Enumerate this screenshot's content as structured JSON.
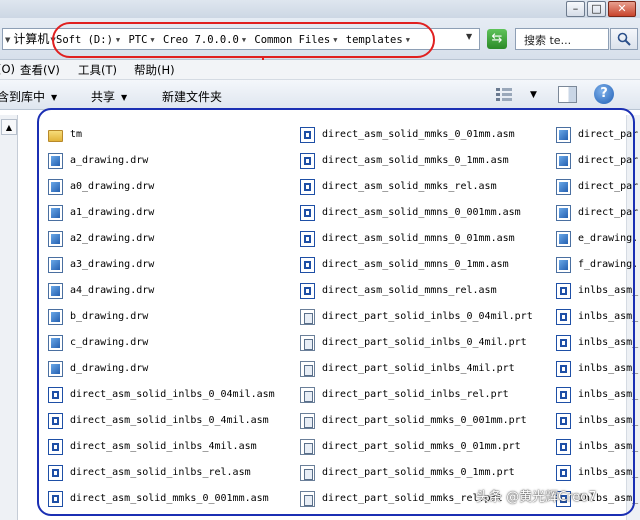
{
  "address": {
    "computer_label": "计算机",
    "breadcrumbs": [
      "Soft (D:)",
      "PTC",
      "Creo 7.0.0.0",
      "Common Files",
      "templates"
    ],
    "search_placeholder": "搜索 te..."
  },
  "menu": [
    {
      "label": "(O)"
    },
    {
      "label": "查看(V)"
    },
    {
      "label": "工具(T)"
    },
    {
      "label": "帮助(H)"
    }
  ],
  "toolbar": {
    "include_in_library": "含到库中",
    "share": "共享",
    "new_folder": "新建文件夹"
  },
  "files": [
    [
      {
        "name": "tm",
        "type": "folder"
      },
      {
        "name": "a_drawing.drw",
        "type": "drw"
      },
      {
        "name": "a0_drawing.drw",
        "type": "drw"
      },
      {
        "name": "a1_drawing.drw",
        "type": "drw"
      },
      {
        "name": "a2_drawing.drw",
        "type": "drw"
      },
      {
        "name": "a3_drawing.drw",
        "type": "drw"
      },
      {
        "name": "a4_drawing.drw",
        "type": "drw"
      },
      {
        "name": "b_drawing.drw",
        "type": "drw"
      },
      {
        "name": "c_drawing.drw",
        "type": "drw"
      },
      {
        "name": "d_drawing.drw",
        "type": "drw"
      },
      {
        "name": "direct_asm_solid_inlbs_0_04mil.asm",
        "type": "asm"
      },
      {
        "name": "direct_asm_solid_inlbs_0_4mil.asm",
        "type": "asm"
      },
      {
        "name": "direct_asm_solid_inlbs_4mil.asm",
        "type": "asm"
      },
      {
        "name": "direct_asm_solid_inlbs_rel.asm",
        "type": "asm"
      },
      {
        "name": "direct_asm_solid_mmks_0_001mm.asm",
        "type": "asm"
      }
    ],
    [
      {
        "name": "direct_asm_solid_mmks_0_01mm.asm",
        "type": "asm"
      },
      {
        "name": "direct_asm_solid_mmks_0_1mm.asm",
        "type": "asm"
      },
      {
        "name": "direct_asm_solid_mmks_rel.asm",
        "type": "asm"
      },
      {
        "name": "direct_asm_solid_mmns_0_001mm.asm",
        "type": "asm"
      },
      {
        "name": "direct_asm_solid_mmns_0_01mm.asm",
        "type": "asm"
      },
      {
        "name": "direct_asm_solid_mmns_0_1mm.asm",
        "type": "asm"
      },
      {
        "name": "direct_asm_solid_mmns_rel.asm",
        "type": "asm"
      },
      {
        "name": "direct_part_solid_inlbs_0_04mil.prt",
        "type": "prt"
      },
      {
        "name": "direct_part_solid_inlbs_0_4mil.prt",
        "type": "prt"
      },
      {
        "name": "direct_part_solid_inlbs_4mil.prt",
        "type": "prt"
      },
      {
        "name": "direct_part_solid_inlbs_rel.prt",
        "type": "prt"
      },
      {
        "name": "direct_part_solid_mmks_0_001mm.prt",
        "type": "prt"
      },
      {
        "name": "direct_part_solid_mmks_0_01mm.prt",
        "type": "prt"
      },
      {
        "name": "direct_part_solid_mmks_0_1mm.prt",
        "type": "prt"
      },
      {
        "name": "direct_part_solid_mmks_rel.prt",
        "type": "prt"
      }
    ],
    [
      {
        "name": "direct_par",
        "type": "drw"
      },
      {
        "name": "direct_par",
        "type": "drw"
      },
      {
        "name": "direct_par",
        "type": "drw"
      },
      {
        "name": "direct_par",
        "type": "drw"
      },
      {
        "name": "e_drawing.",
        "type": "drw"
      },
      {
        "name": "f_drawing.",
        "type": "drw"
      },
      {
        "name": "inlbs_asm_",
        "type": "asm"
      },
      {
        "name": "inlbs_asm_",
        "type": "asm"
      },
      {
        "name": "inlbs_asm_",
        "type": "asm"
      },
      {
        "name": "inlbs_asm_",
        "type": "asm"
      },
      {
        "name": "inlbs_asm_",
        "type": "asm"
      },
      {
        "name": "inlbs_asm_",
        "type": "asm"
      },
      {
        "name": "inlbs_asm_",
        "type": "asm"
      },
      {
        "name": "inlbs_asm_",
        "type": "asm"
      },
      {
        "name": "inlbs_asm_",
        "type": "asm"
      }
    ]
  ],
  "watermark": "头条 @黄光辉Creo7",
  "annotation_colors": {
    "highlight": "#e02020",
    "frame": "#1b2fb3"
  }
}
